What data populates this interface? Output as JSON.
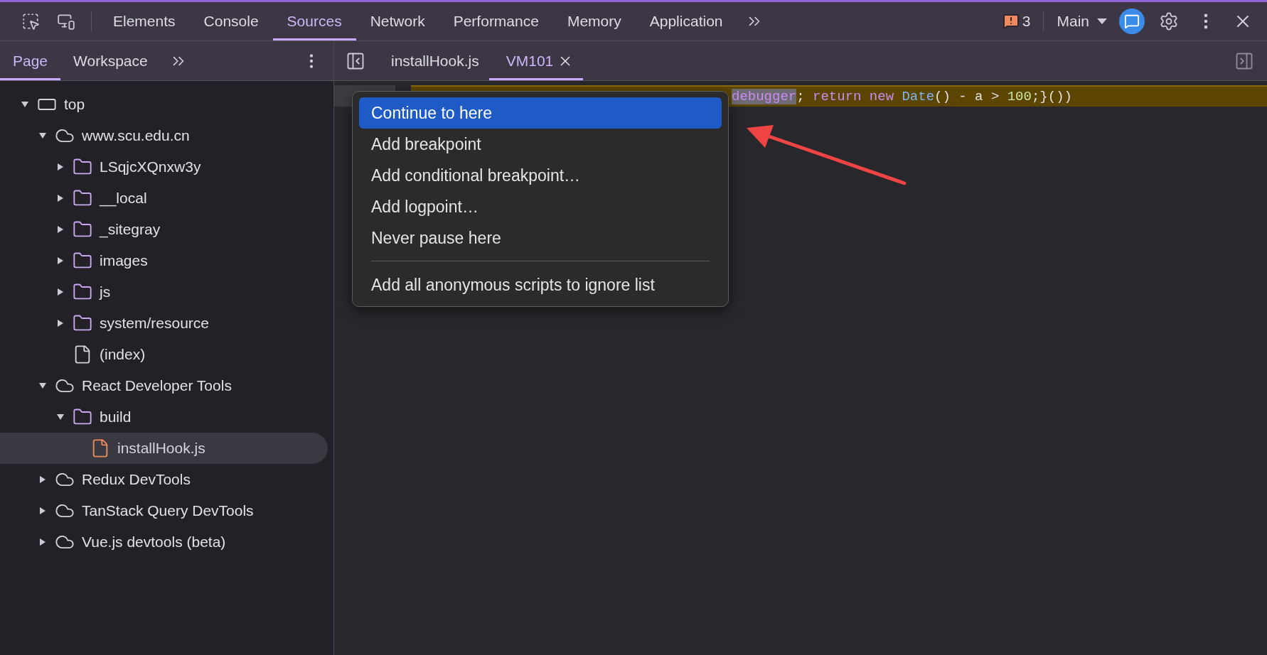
{
  "main_tabs": [
    {
      "label": "Elements",
      "selected": false
    },
    {
      "label": "Console",
      "selected": false
    },
    {
      "label": "Sources",
      "selected": true
    },
    {
      "label": "Network",
      "selected": false
    },
    {
      "label": "Performance",
      "selected": false
    },
    {
      "label": "Memory",
      "selected": false
    },
    {
      "label": "Application",
      "selected": false
    }
  ],
  "issues_count": "3",
  "target": "Main",
  "navigator_tabs": [
    {
      "label": "Page",
      "selected": true
    },
    {
      "label": "Workspace",
      "selected": false
    }
  ],
  "editor_tabs": [
    {
      "label": "installHook.js",
      "selected": false,
      "closable": false
    },
    {
      "label": "VM101",
      "selected": true,
      "closable": true
    }
  ],
  "tree": [
    {
      "label": "top",
      "kind": "frame",
      "expanded": true,
      "selected": false,
      "children": [
        {
          "label": "www.scu.edu.cn",
          "kind": "cloud",
          "expanded": true,
          "selected": false,
          "children": [
            {
              "label": "LSqjcXQnxw3y",
              "kind": "folder",
              "expanded": false,
              "selected": false
            },
            {
              "label": "__local",
              "kind": "folder",
              "expanded": false,
              "selected": false
            },
            {
              "label": "_sitegray",
              "kind": "folder",
              "expanded": false,
              "selected": false
            },
            {
              "label": "images",
              "kind": "folder",
              "expanded": false,
              "selected": false
            },
            {
              "label": "js",
              "kind": "folder",
              "expanded": false,
              "selected": false
            },
            {
              "label": "system/resource",
              "kind": "folder",
              "expanded": false,
              "selected": false
            },
            {
              "label": "(index)",
              "kind": "file",
              "selected": false
            }
          ]
        },
        {
          "label": "React Developer Tools",
          "kind": "cloud",
          "expanded": true,
          "selected": false,
          "children": [
            {
              "label": "build",
              "kind": "folder",
              "expanded": true,
              "selected": false,
              "children": [
                {
                  "label": "installHook.js",
                  "kind": "script",
                  "selected": true
                }
              ]
            }
          ]
        },
        {
          "label": "Redux DevTools",
          "kind": "cloud",
          "expanded": false,
          "selected": false
        },
        {
          "label": "TanStack Query DevTools",
          "kind": "cloud",
          "expanded": false,
          "selected": false
        },
        {
          "label": "Vue.js devtools (beta)",
          "kind": "cloud",
          "expanded": false,
          "selected": false
        }
      ]
    }
  ],
  "code_line": [
    {
      "text": "debugger",
      "kind": "keyword",
      "highlighted": true
    },
    {
      "text": "; ",
      "kind": "plain",
      "highlighted": false
    },
    {
      "text": "return ",
      "kind": "keyword",
      "highlighted": false
    },
    {
      "text": "new ",
      "kind": "keyword",
      "highlighted": false
    },
    {
      "text": "Date",
      "kind": "class",
      "highlighted": false
    },
    {
      "text": "() - a > ",
      "kind": "plain",
      "highlighted": false
    },
    {
      "text": "100",
      "kind": "number",
      "highlighted": false
    },
    {
      "text": ";}())",
      "kind": "plain",
      "highlighted": false
    }
  ],
  "context_menu": [
    {
      "kind": "item",
      "label": "Continue to here",
      "selected": true
    },
    {
      "kind": "item",
      "label": "Add breakpoint",
      "selected": false
    },
    {
      "kind": "item",
      "label": "Add conditional breakpoint…",
      "selected": false
    },
    {
      "kind": "item",
      "label": "Add logpoint…",
      "selected": false
    },
    {
      "kind": "item",
      "label": "Never pause here",
      "selected": false
    },
    {
      "kind": "separator"
    },
    {
      "kind": "item",
      "label": "Add all anonymous scripts to ignore list",
      "selected": false
    }
  ]
}
